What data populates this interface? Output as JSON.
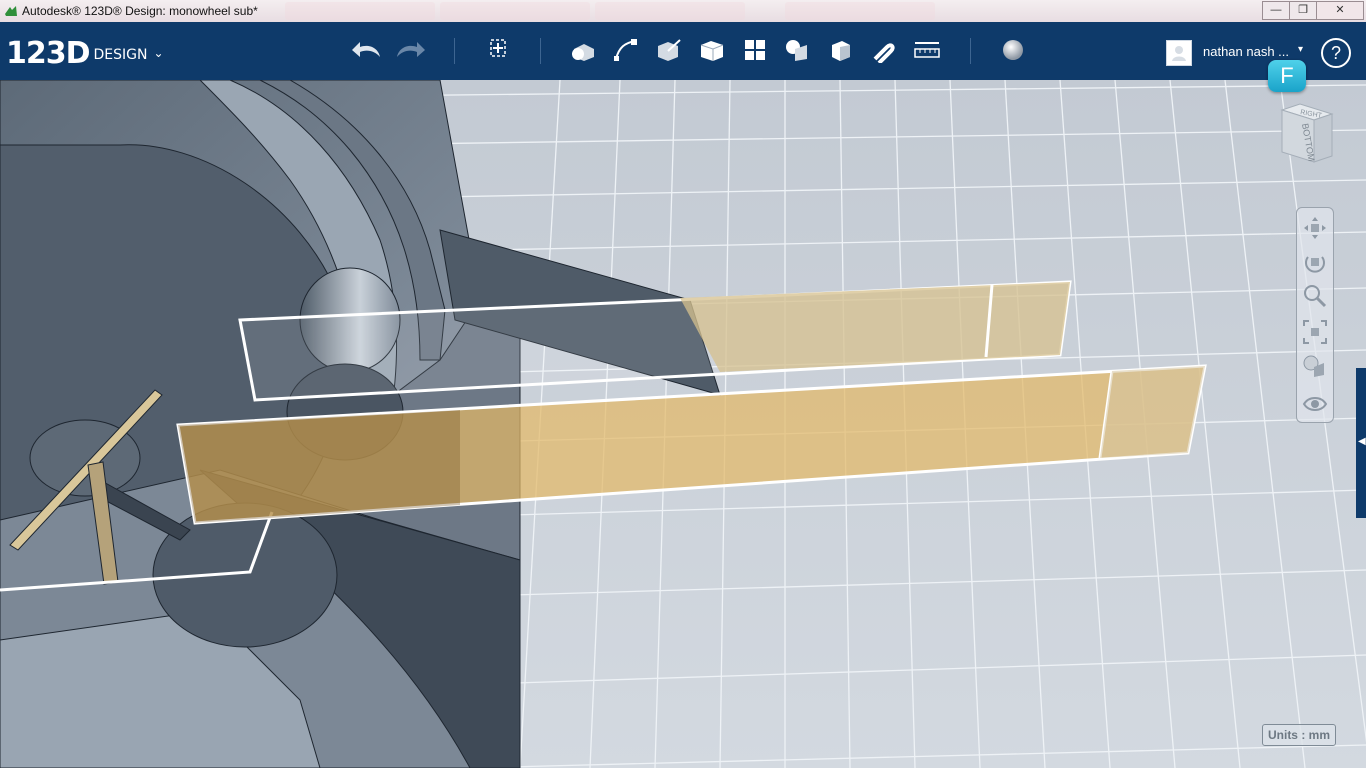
{
  "window": {
    "title": "Autodesk® 123D® Design: monowheel sub*",
    "minimize_label": "—",
    "maximize_label": "❐",
    "close_label": "✕"
  },
  "brand": {
    "logo_big": "123D",
    "logo_small": "DESIGN",
    "chevron": "⌄"
  },
  "toolbar": {
    "tools": [
      {
        "icon": "undo-icon"
      },
      {
        "icon": "redo-icon"
      },
      {
        "icon": "transform-icon"
      },
      {
        "icon": "primitives-icon"
      },
      {
        "icon": "sketch-icon"
      },
      {
        "icon": "construct-icon"
      },
      {
        "icon": "modify-icon"
      },
      {
        "icon": "pattern-icon"
      },
      {
        "icon": "grouping-icon"
      },
      {
        "icon": "combine-icon"
      },
      {
        "icon": "snap-icon"
      },
      {
        "icon": "measure-icon"
      },
      {
        "icon": "material-icon"
      }
    ]
  },
  "user": {
    "name": "nathan nash ...",
    "caret": "▾"
  },
  "help_label": "?",
  "f_badge": "F",
  "viewcube": {
    "top_face": "RIGHT",
    "side_face": "BOTTOM"
  },
  "navbar": [
    "pan-icon",
    "orbit-icon",
    "zoom-icon",
    "fit-icon",
    "views-icon",
    "visibility-icon"
  ],
  "units_label": "Units : mm",
  "colors": {
    "toolbar": "#0e3a6a",
    "selection": "#e3b866",
    "accent": "#29b4d8"
  }
}
